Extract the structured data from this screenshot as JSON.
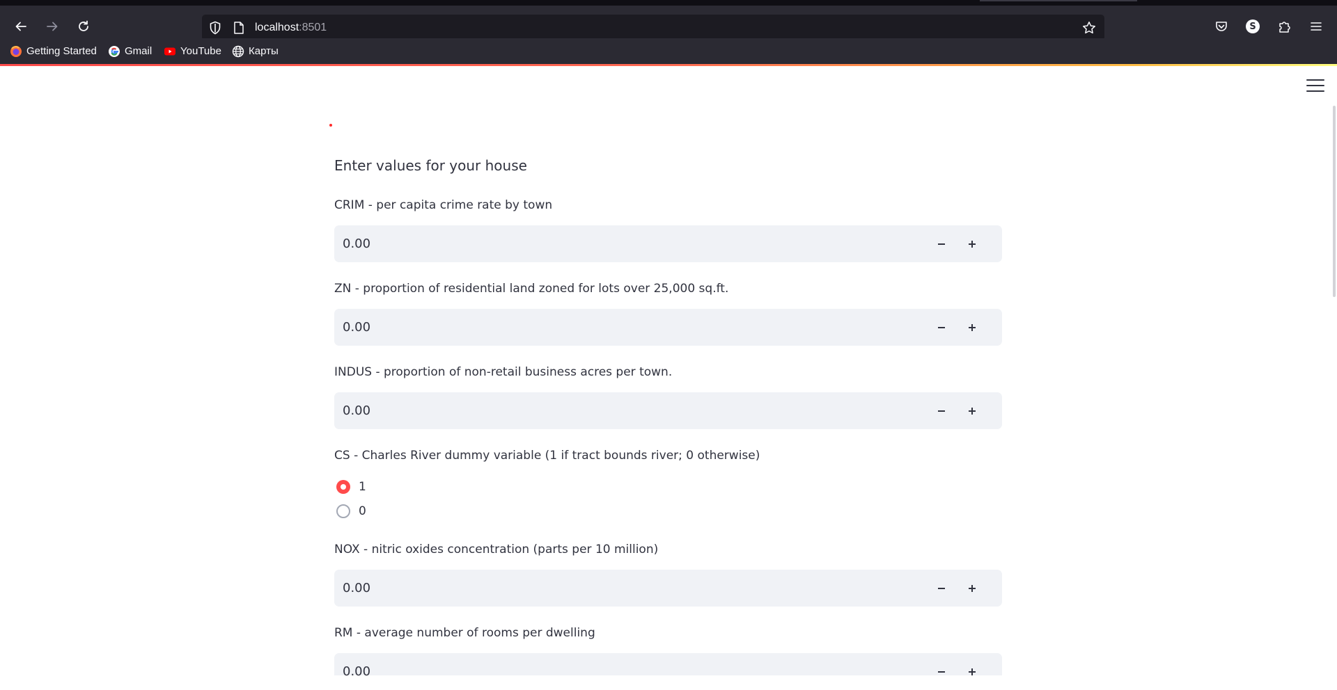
{
  "browser": {
    "url_host": "localhost",
    "url_port": ":8501",
    "bookmarks": [
      {
        "label": "Getting Started",
        "icon": "firefox-icon"
      },
      {
        "label": "Gmail",
        "icon": "google-icon"
      },
      {
        "label": "YouTube",
        "icon": "youtube-icon"
      },
      {
        "label": "Карты",
        "icon": "globe-icon"
      }
    ],
    "profile_initial": "S"
  },
  "app": {
    "heading": "Enter values for your house",
    "fields": [
      {
        "label": "CRIM - per capita crime rate by town",
        "value": "0.00"
      },
      {
        "label": "ZN - proportion of residential land zoned for lots over 25,000 sq.ft.",
        "value": "0.00"
      },
      {
        "label": "INDUS - proportion of non-retail business acres per town.",
        "value": "0.00"
      },
      {
        "label": "NOX - nitric oxides concentration (parts per 10 million)",
        "value": "0.00"
      },
      {
        "label": "RM - average number of rooms per dwelling",
        "value": "0.00"
      }
    ],
    "radio": {
      "label": "CS - Charles River dummy variable (1 if tract bounds river; 0 otherwise)",
      "options": [
        "1",
        "0"
      ],
      "selected": "1"
    },
    "accent_color": "#ff4b4b"
  }
}
